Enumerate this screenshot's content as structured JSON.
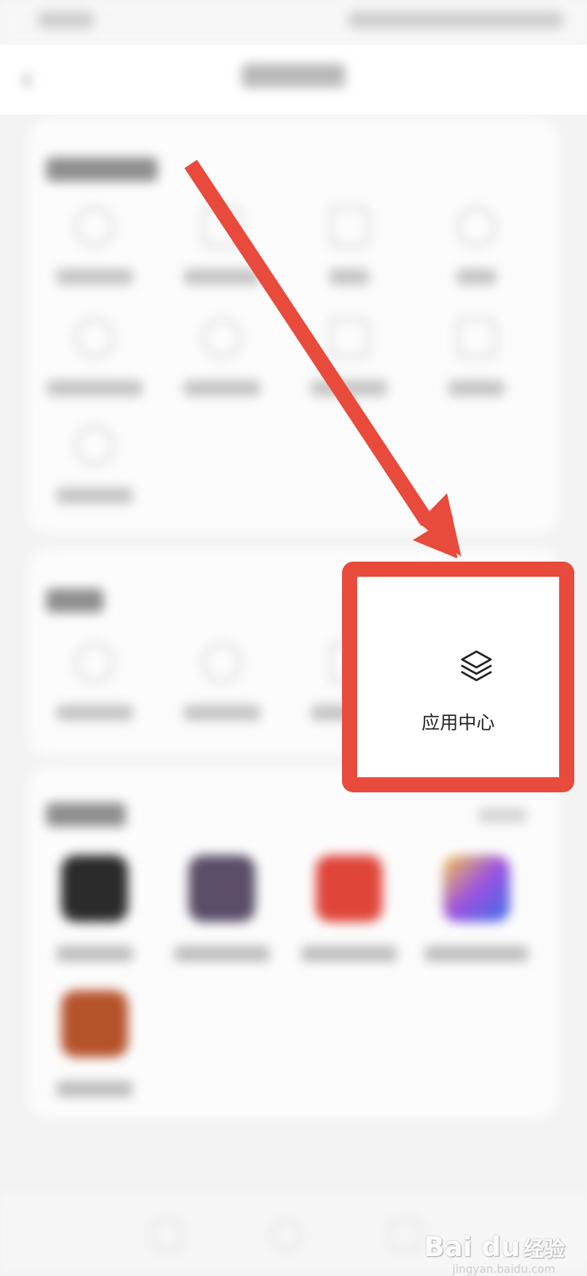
{
  "highlight": {
    "label": "应用中心",
    "icon": "layers-icon",
    "border_color": "#e84a3c"
  },
  "arrow": {
    "color": "#e84a3c"
  },
  "watermark": {
    "brand": "Bai du",
    "cn": "经验",
    "sub": "jingyan.baidu.com"
  }
}
